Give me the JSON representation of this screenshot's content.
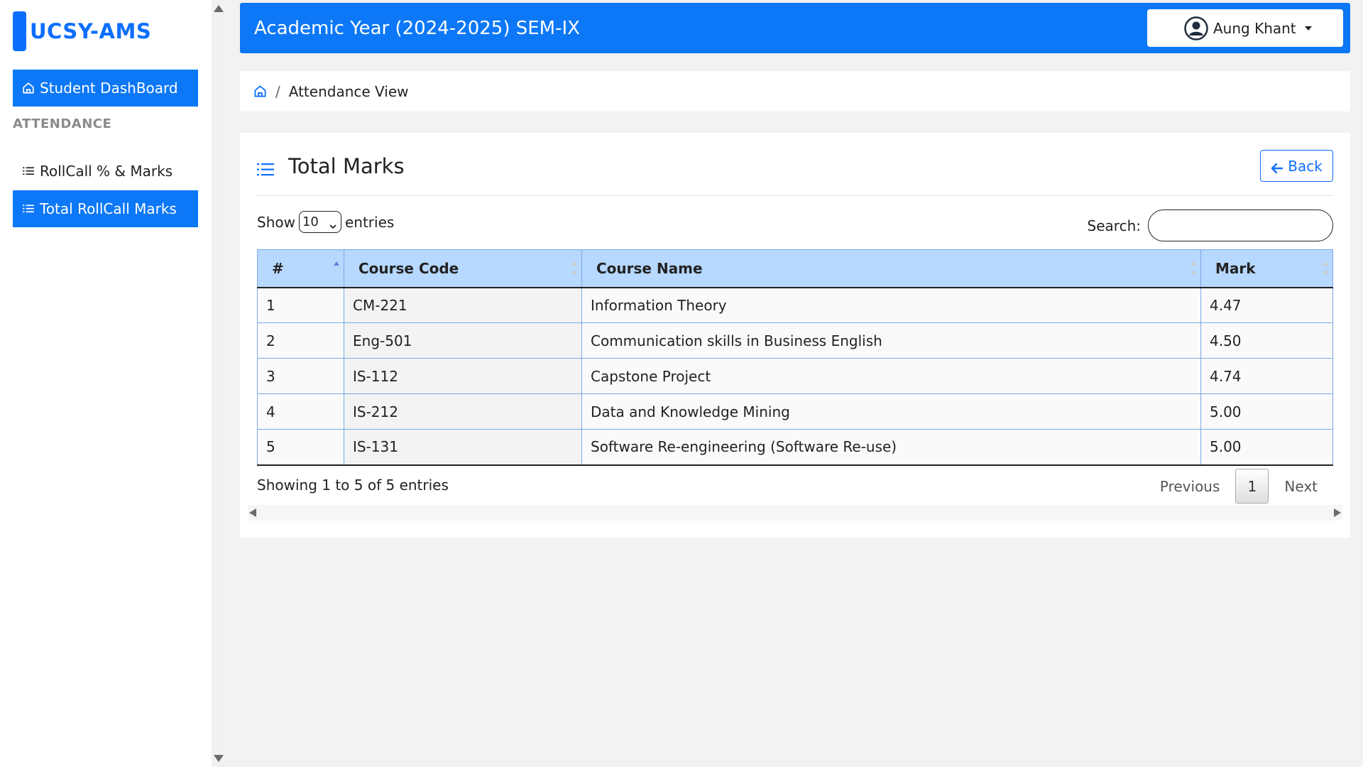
{
  "sidebar": {
    "brand": "UCSY-AMS",
    "dashboard_label": "Student DashBoard",
    "section_label": "ATTENDANCE",
    "items": [
      {
        "label": "RollCall % & Marks"
      },
      {
        "label": "Total RollCall Marks"
      }
    ]
  },
  "header": {
    "title": "Academic Year (2024-2025) SEM-IX",
    "user_name": "Aung Khant"
  },
  "breadcrumb": {
    "current": "Attendance View"
  },
  "card": {
    "title": "Total Marks",
    "back_label": "Back",
    "show_label": "Show",
    "entries_label": "entries",
    "page_length": "10",
    "search_label": "Search:",
    "search_value": ""
  },
  "table": {
    "columns": [
      "#",
      "Course Code",
      "Course Name",
      "Mark"
    ],
    "rows": [
      {
        "num": "1",
        "code": "CM-221",
        "name": "Information Theory",
        "mark": "4.47"
      },
      {
        "num": "2",
        "code": "Eng-501",
        "name": "Communication skills in Business English",
        "mark": "4.50"
      },
      {
        "num": "3",
        "code": "IS-112",
        "name": "Capstone Project",
        "mark": "4.74"
      },
      {
        "num": "4",
        "code": "IS-212",
        "name": "Data and Knowledge Mining",
        "mark": "5.00"
      },
      {
        "num": "5",
        "code": "IS-131",
        "name": "Software Re-engineering (Software Re-use)",
        "mark": "5.00"
      }
    ]
  },
  "footer": {
    "info": "Showing 1 to 5 of 5 entries",
    "previous": "Previous",
    "page": "1",
    "next": "Next"
  },
  "colors": {
    "primary": "#0d78f7",
    "header_row": "#b7d8ff"
  },
  "icons": {
    "dashboard": "home-icon",
    "list": "list-icon",
    "user": "user-circle-icon",
    "back": "arrow-left-icon"
  }
}
